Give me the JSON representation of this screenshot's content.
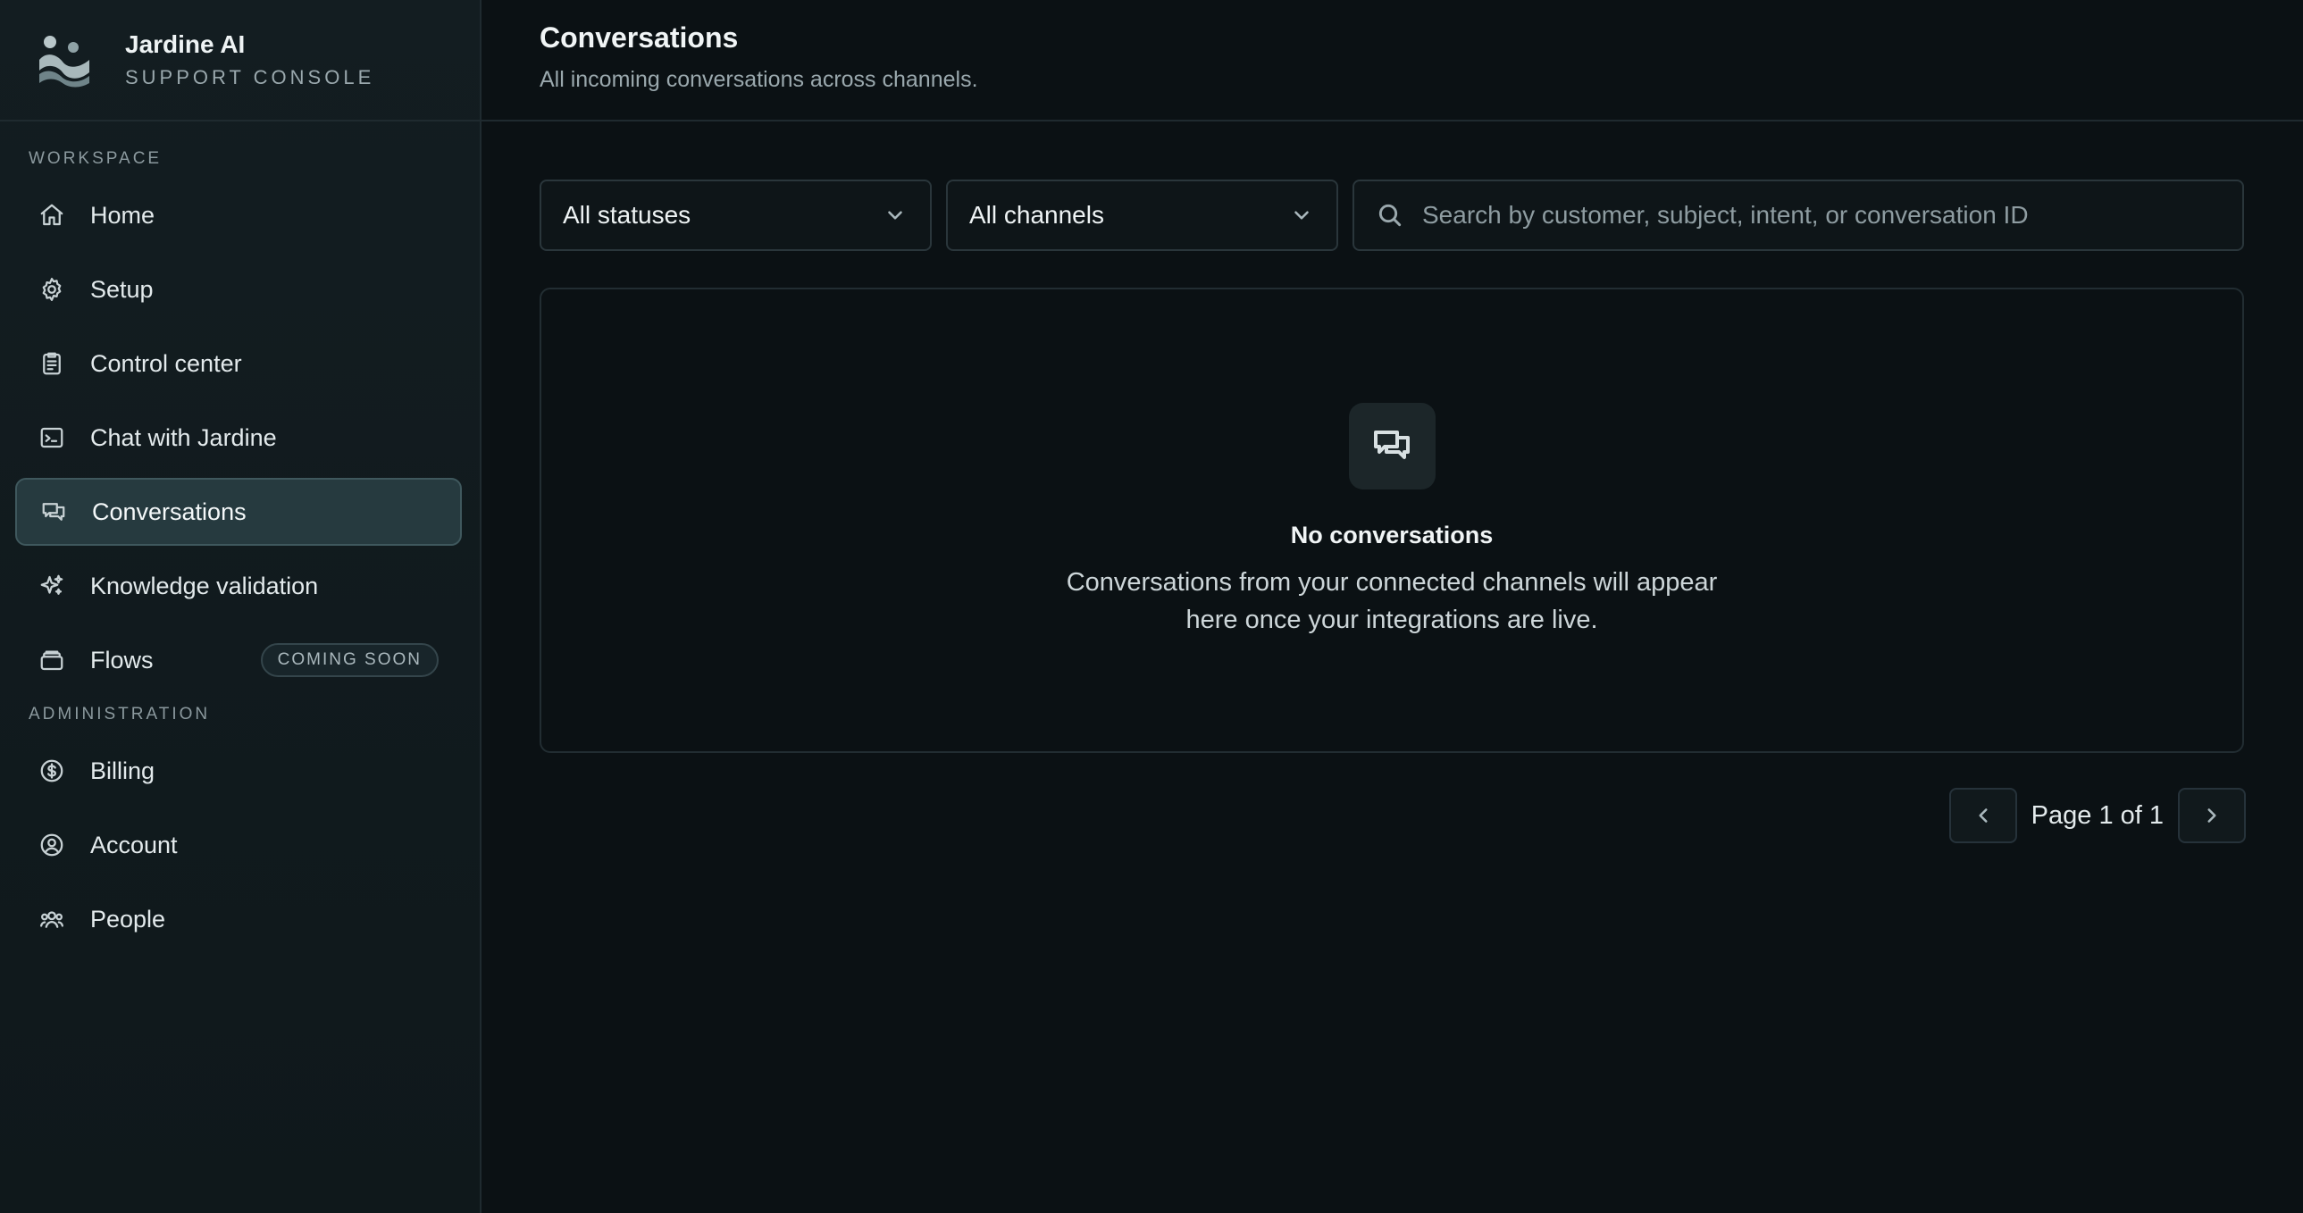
{
  "brand": {
    "title": "Jardine AI",
    "subtitle": "SUPPORT CONSOLE"
  },
  "sidebar": {
    "sections": [
      {
        "label": "WORKSPACE",
        "items": [
          {
            "label": "Home",
            "icon": "home-icon"
          },
          {
            "label": "Setup",
            "icon": "gear-icon"
          },
          {
            "label": "Control center",
            "icon": "clipboard-icon"
          },
          {
            "label": "Chat with Jardine",
            "icon": "terminal-icon"
          },
          {
            "label": "Conversations",
            "icon": "chat-bubbles-icon",
            "active": true
          },
          {
            "label": "Knowledge validation",
            "icon": "sparkles-icon"
          },
          {
            "label": "Flows",
            "icon": "layers-icon",
            "badge": "COMING SOON"
          }
        ]
      },
      {
        "label": "ADMINISTRATION",
        "items": [
          {
            "label": "Billing",
            "icon": "dollar-circle-icon"
          },
          {
            "label": "Account",
            "icon": "user-circle-icon"
          },
          {
            "label": "People",
            "icon": "users-icon"
          }
        ]
      }
    ]
  },
  "header": {
    "title": "Conversations",
    "subtitle": "All incoming conversations across channels."
  },
  "filters": {
    "status": "All statuses",
    "channel": "All channels",
    "search_placeholder": "Search by customer, subject, intent, or conversation ID"
  },
  "empty_state": {
    "icon": "chat-bubbles-icon",
    "title": "No conversations",
    "description": "Conversations from your connected channels will appear here once your integrations are live."
  },
  "pagination": {
    "label": "Page 1 of 1"
  },
  "colors": {
    "background": "#0b1114",
    "sidebar": "#131d21",
    "active_item": "#263a3f",
    "border": "#1f2a2f"
  }
}
